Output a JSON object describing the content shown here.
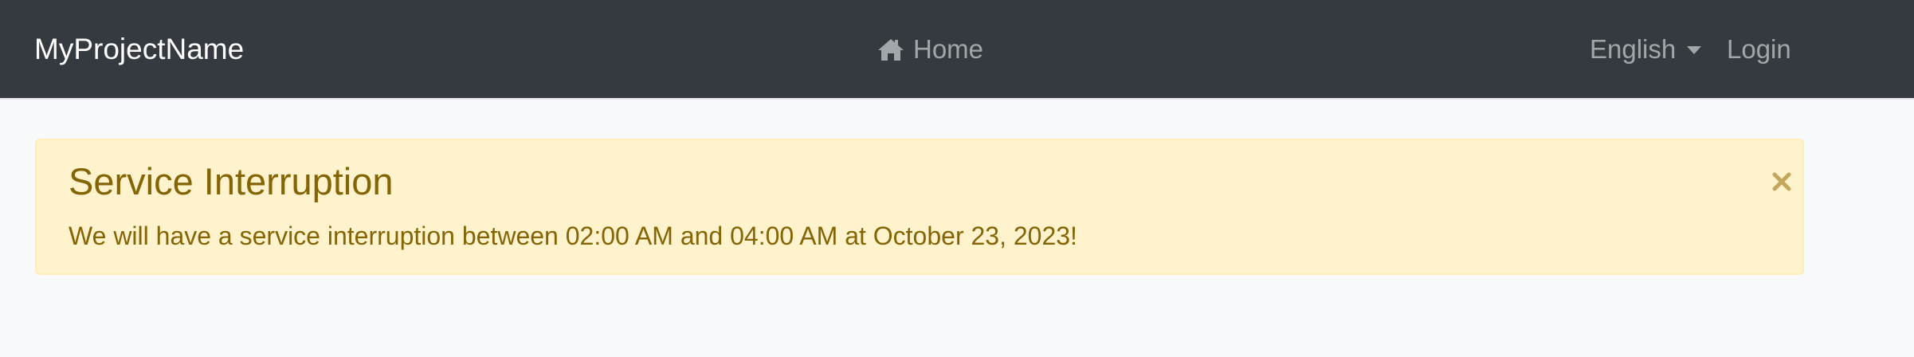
{
  "navbar": {
    "brand": "MyProjectName",
    "home_icon": "home-icon",
    "home_label": "Home",
    "language_label": "English",
    "language_caret_icon": "caret-down-icon",
    "login_label": "Login",
    "background_color": "#343a40"
  },
  "alert": {
    "title": "Service Interruption",
    "message": "We will have a service interruption between 02:00 AM and 04:00 AM at October 23, 2023!",
    "close_icon": "close-icon",
    "background_color": "#fff3cd",
    "text_color": "#856404"
  }
}
